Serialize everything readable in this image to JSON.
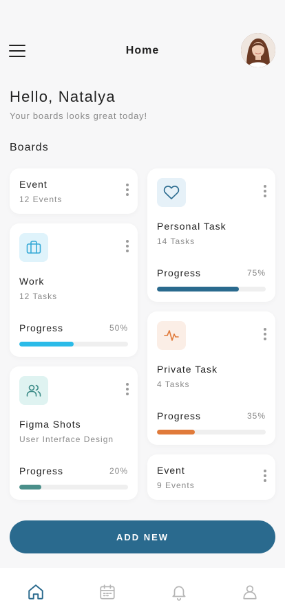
{
  "header": {
    "title": "Home",
    "menu_icon": "hamburger-menu-icon"
  },
  "greeting": {
    "title": "Hello, Natalya",
    "subtitle": "Your boards looks great today!"
  },
  "section_title": "Boards",
  "colors": {
    "primary": "#2a6a8e",
    "work_progress": "#2bbbe8",
    "personal_progress": "#2a6a8e",
    "private_progress": "#e07a3a",
    "figma_progress": "#4a8f8a",
    "work_icon": "#35a9d6",
    "figma_icon": "#3a8a86",
    "personal_icon": "#2a6a8e",
    "private_icon": "#e07a3a"
  },
  "boards": {
    "event_left": {
      "title": "Event",
      "subtitle": "12 Events"
    },
    "work": {
      "title": "Work",
      "subtitle": "12 Tasks",
      "icon": "briefcase-icon",
      "progress_label": "Progress",
      "progress_text": "50%",
      "progress": 0.5
    },
    "figma": {
      "title": "Figma Shots",
      "subtitle": "User Interface Design",
      "icon": "users-icon",
      "progress_label": "Progress",
      "progress_text": "20%",
      "progress": 0.2
    },
    "personal": {
      "title": "Personal Task",
      "subtitle": "14 Tasks",
      "icon": "heart-icon",
      "progress_label": "Progress",
      "progress_text": "75%",
      "progress": 0.75
    },
    "private": {
      "title": "Private Task",
      "subtitle": "4 Tasks",
      "icon": "activity-icon",
      "progress_label": "Progress",
      "progress_text": "35%",
      "progress": 0.35
    },
    "event_right": {
      "title": "Event",
      "subtitle": "9 Events"
    }
  },
  "add_button": "ADD NEW",
  "tabbar": [
    "home-icon",
    "calendar-icon",
    "bell-icon",
    "profile-icon"
  ]
}
